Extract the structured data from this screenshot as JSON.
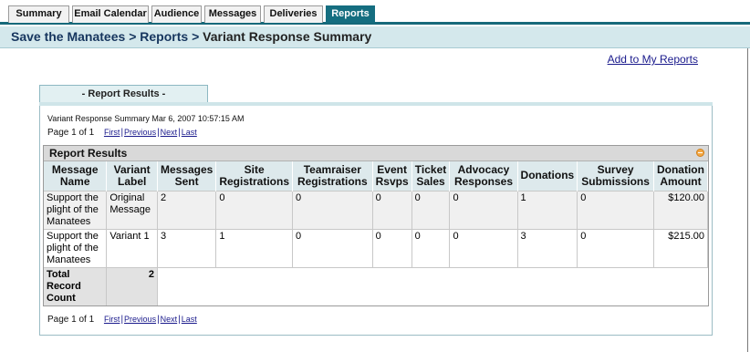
{
  "tabs": [
    {
      "label": "Summary",
      "active": false
    },
    {
      "label": "Email Calendar",
      "active": false
    },
    {
      "label": "Audience",
      "active": false
    },
    {
      "label": "Messages",
      "active": false
    },
    {
      "label": "Deliveries",
      "active": false
    },
    {
      "label": "Reports",
      "active": true
    }
  ],
  "breadcrumb": {
    "part1": "Save the Manatees",
    "sep": ">",
    "part2": "Reports",
    "current": "Variant Response Summary"
  },
  "add_to_reports_label": "Add to My Reports",
  "section_tab_label": "- Report Results -",
  "report_meta": "Variant Response Summary Mar 6, 2007 10:57:15 AM",
  "pager": {
    "page_text": "Page 1 of 1",
    "first": "First",
    "previous": "Previous",
    "next": "Next",
    "last": "Last",
    "bar": "|"
  },
  "results_title": "Report Results",
  "columns": [
    [
      "Message",
      "Name"
    ],
    [
      "Variant",
      "Label"
    ],
    [
      "Messages",
      "Sent"
    ],
    [
      "Site",
      "Registrations"
    ],
    [
      "Teamraiser",
      "Registrations"
    ],
    [
      "Event",
      "Rsvps"
    ],
    [
      "Ticket",
      "Sales"
    ],
    [
      "Advocacy",
      "Responses"
    ],
    [
      "Donations",
      ""
    ],
    [
      "Survey",
      "Submissions"
    ],
    [
      "Donation",
      "Amount"
    ]
  ],
  "rows": [
    {
      "message_name": [
        "Support the",
        "plight of the",
        "Manatees"
      ],
      "variant_label": [
        "Original",
        "Message"
      ],
      "messages_sent": "2",
      "site_registrations": "0",
      "teamraiser_registrations": "0",
      "event_rsvps": "0",
      "ticket_sales": "0",
      "advocacy_responses": "0",
      "donations": "1",
      "survey_submissions": "0",
      "donation_amount": "$120.00"
    },
    {
      "message_name": [
        "Support the",
        "plight of the",
        "Manatees"
      ],
      "variant_label": [
        "Variant 1"
      ],
      "messages_sent": "3",
      "site_registrations": "1",
      "teamraiser_registrations": "0",
      "event_rsvps": "0",
      "ticket_sales": "0",
      "advocacy_responses": "0",
      "donations": "3",
      "survey_submissions": "0",
      "donation_amount": "$215.00"
    }
  ],
  "total": {
    "label_line1": "Total Record",
    "label_line2": "Count",
    "value": "2"
  },
  "colors": {
    "tab_active": "#156e80",
    "breadcrumb_bg": "#d4e8ec",
    "link": "#1a1a8c",
    "collapse_icon": "#f4a742"
  }
}
